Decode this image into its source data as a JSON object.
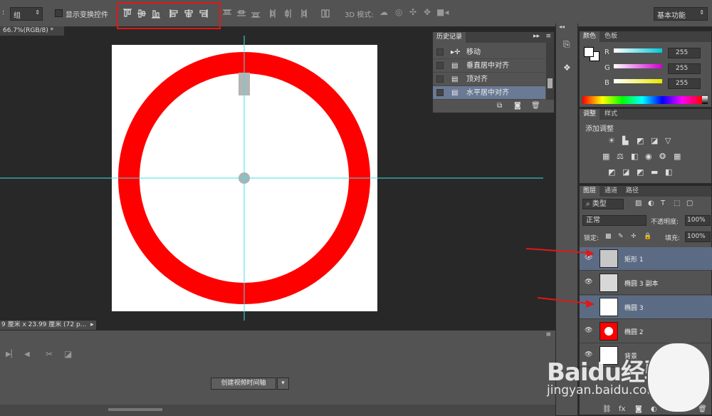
{
  "options_bar": {
    "auto_select_value": "组",
    "show_transform_label": "显示变换控件",
    "mode_3d_label": "3D 模式:",
    "workspace_value": "基本功能"
  },
  "document": {
    "tab_label": "66.7%(RGB/8) *",
    "status_text": "9 厘米 x 23.99 厘米 (72 p..."
  },
  "history_panel": {
    "title": "历史记录",
    "items": [
      {
        "label": "移动"
      },
      {
        "label": "垂直居中对齐"
      },
      {
        "label": "顶对齐"
      },
      {
        "label": "水平居中对齐"
      }
    ]
  },
  "color_panel": {
    "tabs": [
      "颜色",
      "色板"
    ],
    "channels": [
      {
        "name": "R",
        "value": "255",
        "color": "#00c8d8"
      },
      {
        "name": "G",
        "value": "255",
        "color": "#d000d0"
      },
      {
        "name": "B",
        "value": "255",
        "color": "#e8e800"
      }
    ]
  },
  "adjust_panel": {
    "tabs": [
      "调整",
      "样式"
    ],
    "heading": "添加调整"
  },
  "layers_panel": {
    "tabs": [
      "图层",
      "通道",
      "路径"
    ],
    "filter_label": "类型",
    "blend_mode": "正常",
    "opacity_label": "不透明度:",
    "opacity_value": "100%",
    "lock_label": "锁定:",
    "fill_label": "填充:",
    "fill_value": "100%",
    "layers": [
      {
        "name": "矩形 1",
        "highlighted": true
      },
      {
        "name": "椭圆 3 副本",
        "highlighted": false
      },
      {
        "name": "椭圆 3",
        "highlighted": true
      },
      {
        "name": "椭圆 2",
        "highlighted": false
      },
      {
        "name": "背景",
        "highlighted": false
      }
    ]
  },
  "timeline": {
    "create_button": "创建视频时间轴"
  },
  "watermark": {
    "brand": "Baidu经验",
    "url": "jingyan.baidu.com"
  },
  "colors": {
    "ring": "#ff0000",
    "guide": "#40e0e8",
    "annotation": "#e01818"
  }
}
